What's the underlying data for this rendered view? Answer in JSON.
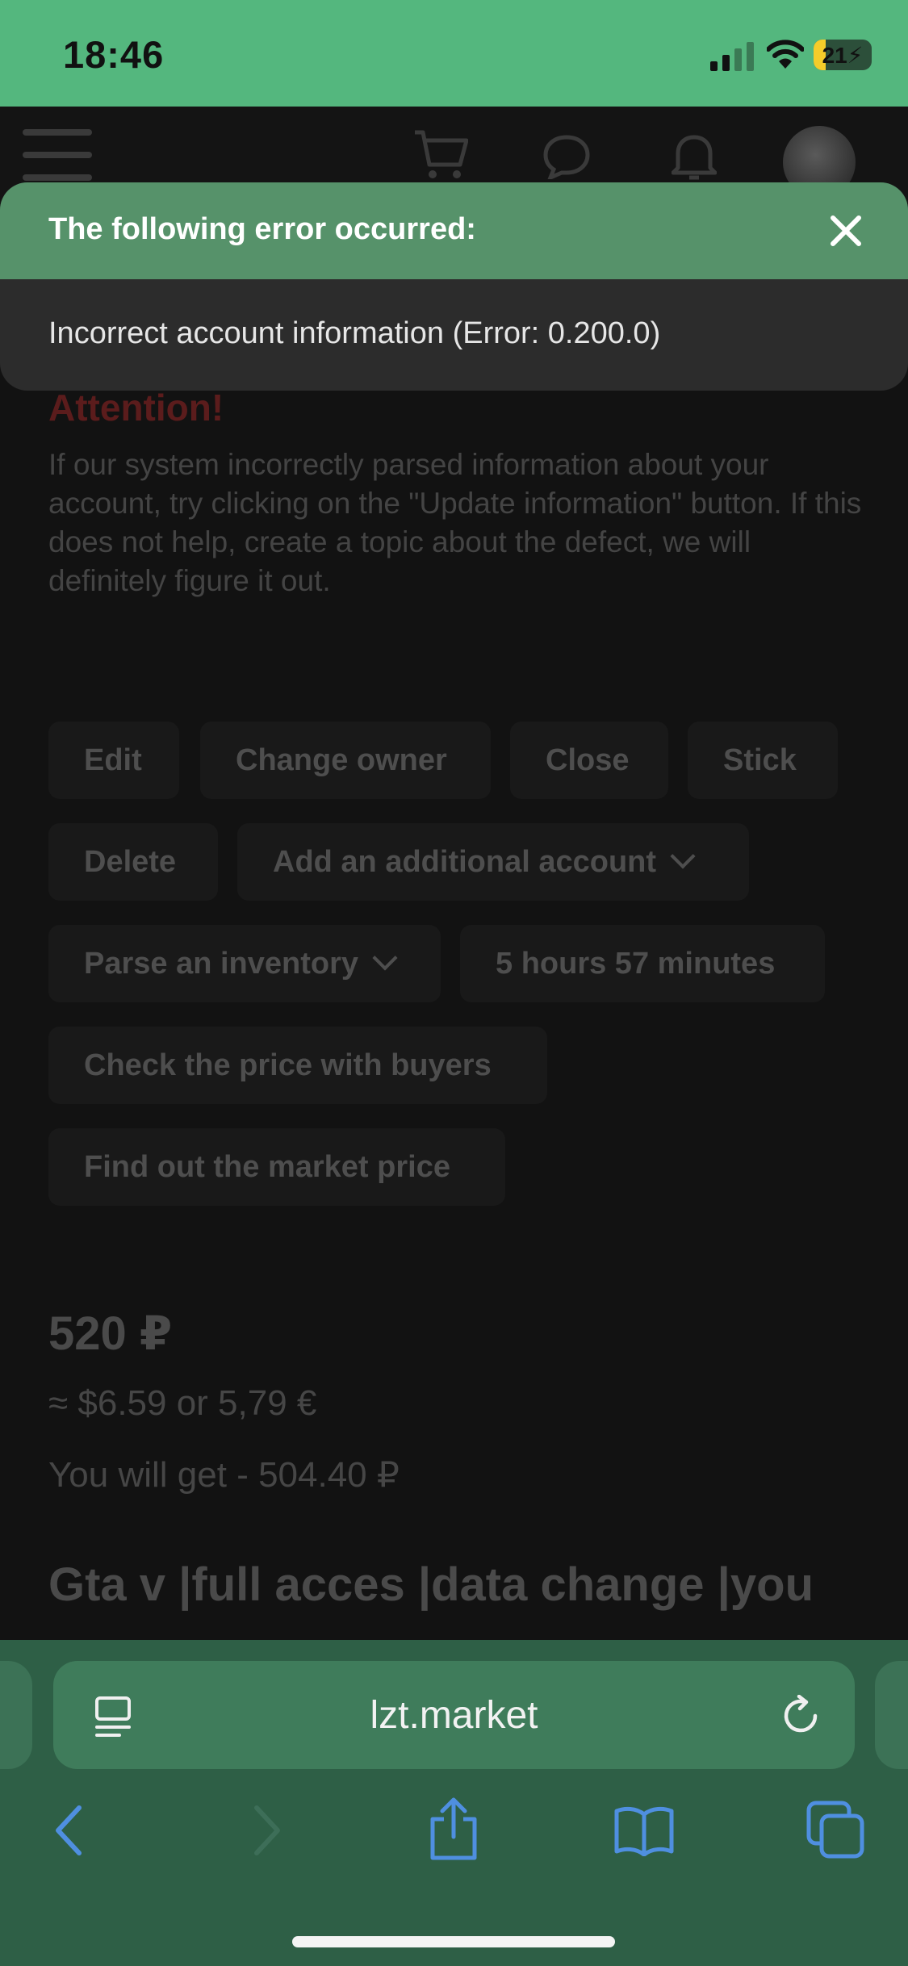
{
  "status_bar": {
    "time": "18:46",
    "battery": "21",
    "battery_level": 0.21,
    "icons": [
      "cellular-signal-icon",
      "wifi-icon",
      "battery-charging-icon"
    ]
  },
  "app_header": {
    "icons": [
      "menu-icon",
      "cart-icon",
      "chat-icon",
      "bell-icon",
      "avatar"
    ]
  },
  "error_dialog": {
    "title": "The following error occurred:",
    "message": "Incorrect account information (Error: 0.200.0)",
    "close_icon": "close-icon"
  },
  "attention": {
    "title": "Attention!",
    "body": "If our system incorrectly parsed information about your account, try clicking on the \"Update information\" button. If this does not help, create a topic about the defect, we will definitely figure it out."
  },
  "actions": {
    "edit": "Edit",
    "change_owner": "Change owner",
    "close": "Close",
    "stick": "Stick",
    "delete": "Delete",
    "add_account": "Add an additional account",
    "parse_inventory": "Parse an inventory",
    "timer": "5 hours 57 minutes",
    "check_price": "Check the price with buyers",
    "market_price": "Find out the market price"
  },
  "pricing": {
    "price": "520 ₽",
    "approx": "≈ $6.59 or 5,79 €",
    "you_get": "You will get - 504.40 ₽"
  },
  "listing": {
    "title": "Gta v |full acces |data change |you"
  },
  "browser": {
    "url": "lzt.market",
    "icons": [
      "reader-icon",
      "reload-icon",
      "back-icon",
      "forward-icon",
      "share-icon",
      "bookmarks-icon",
      "tabs-icon"
    ]
  },
  "colors": {
    "status_bar": "#54b77e",
    "error_header": "#56926a",
    "browser_bar": "#2e5f46",
    "icon_blue": "#4f8fe0"
  }
}
